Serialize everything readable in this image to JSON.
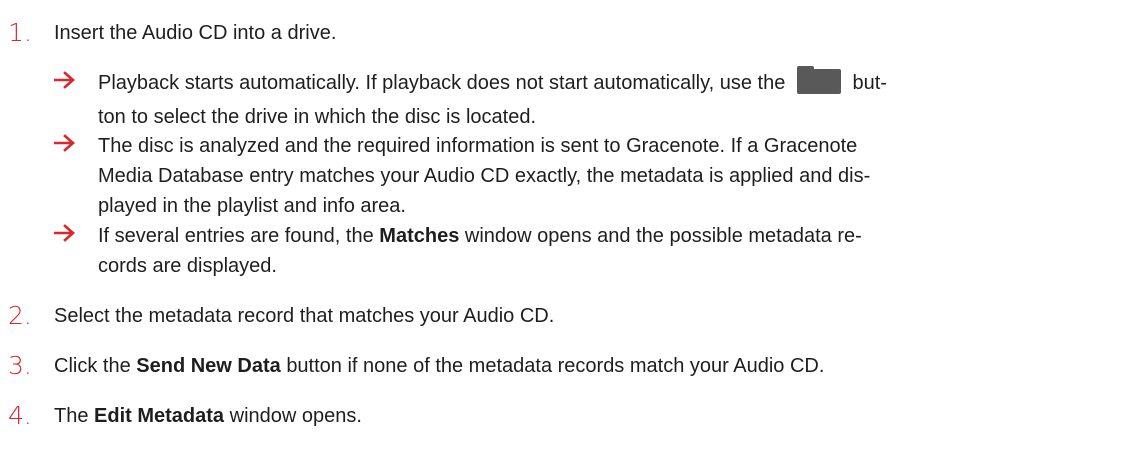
{
  "steps": [
    {
      "number": "1.",
      "text": "Insert the Audio CD into a drive.",
      "results": [
        {
          "line1_pre": "Playback starts automatically. If playback does not start automatically, use the",
          "line1_post": "but-",
          "line2": "ton to select the drive in which the disc is located."
        },
        {
          "lines": [
            "The disc is analyzed and the required information is sent to Gracenote. If a Gracenote",
            "Media Database entry matches your Audio CD exactly, the metadata is applied and dis-",
            "played in the playlist and info area."
          ]
        },
        {
          "line1_pre": "If several entries are found, the",
          "line1_bold": "Matches",
          "line1_post": "window opens and the possible metadata re-",
          "line2": "cords are displayed."
        }
      ]
    },
    {
      "number": "2.",
      "text": "Select the metadata record that matches your Audio CD."
    },
    {
      "number": "3.",
      "pre": "Click the",
      "bold": "Send New Data",
      "post": "button if none of the metadata records match your Audio CD."
    },
    {
      "number": "4.",
      "pre": "The",
      "bold": "Edit Metadata",
      "post": "window opens."
    }
  ],
  "icons": {
    "result_arrow": "arrow-right-icon",
    "drive_button": "folder-icon"
  },
  "colors": {
    "accent": "#d9272e",
    "text": "#1e1e1e",
    "button": "#595959"
  }
}
